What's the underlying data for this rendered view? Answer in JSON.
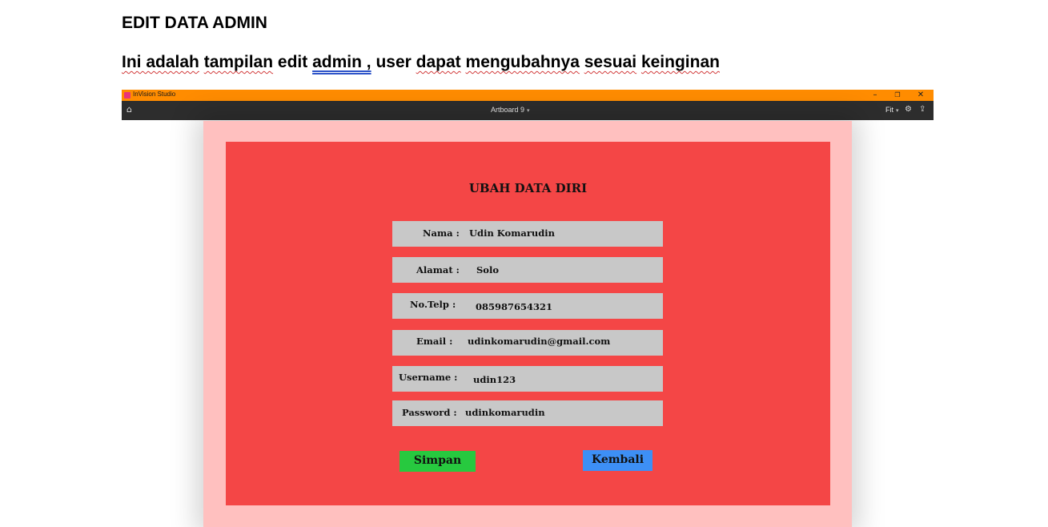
{
  "document": {
    "heading": "EDIT DATA ADMIN",
    "caption": {
      "part1": "Ini adalah",
      "part2": "tampilan",
      "part3": "edit",
      "part4": "admin ,",
      "part5": "user",
      "part6": "dapat",
      "part7": "mengubahnya",
      "part8": "sesuai",
      "part9": "keinginan"
    }
  },
  "window": {
    "app_name": "InVision Studio",
    "minimize": "–",
    "restore": "❐",
    "close": "✕",
    "accent_color": "#ff8c00"
  },
  "toolbar": {
    "home_icon": "⌂",
    "artboard_name": "Artboard 9",
    "dropdown_caret": "▾",
    "zoom": "Fit",
    "settings_icon": "⚙",
    "share_icon": "⇪"
  },
  "form": {
    "title": "UBAH DATA DIRI",
    "fields": [
      {
        "label": "Nama  :",
        "value": "Udin Komarudin"
      },
      {
        "label": "Alamat :",
        "value": "Solo"
      },
      {
        "label": "No.Telp :",
        "value": "085987654321"
      },
      {
        "label": "Email :",
        "value": "udinkomarudin@gmail.com"
      },
      {
        "label": "Username :",
        "value": "udin123"
      },
      {
        "label": "Password :",
        "value": "udinkomarudin"
      }
    ],
    "save_label": "Simpan",
    "back_label": "Kembali",
    "colors": {
      "page": "#ffc0bf",
      "panel": "#f44646",
      "field": "#c8c8c8",
      "save": "#27c93f",
      "back": "#3d8ff5"
    }
  }
}
